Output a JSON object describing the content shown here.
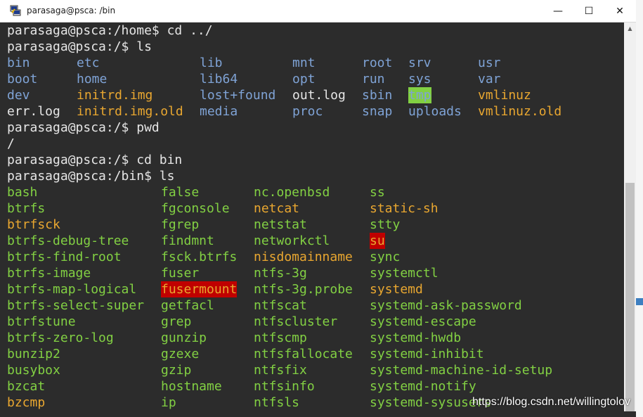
{
  "window": {
    "title": "parasaga@psca: /bin",
    "controls": {
      "minimize": "—",
      "maximize": "☐",
      "close": "✕"
    }
  },
  "terminal": {
    "lines": [
      {
        "text": "parasaga@psca:/home$ cd ../"
      },
      {
        "text": "parasaga@psca:/$ ls"
      },
      {
        "cells": [
          {
            "text": "bin",
            "color": "blue"
          },
          {
            "text": "etc",
            "color": "blue"
          },
          {
            "text": "lib",
            "color": "blue"
          },
          {
            "text": "mnt",
            "color": "blue"
          },
          {
            "text": "root",
            "color": "blue"
          },
          {
            "text": "srv",
            "color": "blue"
          },
          {
            "text": "usr",
            "color": "blue"
          }
        ]
      },
      {
        "cells": [
          {
            "text": "boot",
            "color": "blue"
          },
          {
            "text": "home",
            "color": "blue"
          },
          {
            "text": "lib64",
            "color": "blue"
          },
          {
            "text": "opt",
            "color": "blue"
          },
          {
            "text": "run",
            "color": "blue"
          },
          {
            "text": "sys",
            "color": "blue"
          },
          {
            "text": "var",
            "color": "blue"
          }
        ]
      },
      {
        "cells": [
          {
            "text": "dev",
            "color": "blue"
          },
          {
            "text": "initrd.img",
            "color": "yellow"
          },
          {
            "text": "lost+found",
            "color": "blue"
          },
          {
            "text": "out.log",
            "color": "white"
          },
          {
            "text": "sbin",
            "color": "blue"
          },
          {
            "text": "tmp",
            "color": "hl-tmp"
          },
          {
            "text": "vmlinuz",
            "color": "yellow"
          }
        ]
      },
      {
        "cells": [
          {
            "text": "err.log",
            "color": "white"
          },
          {
            "text": "initrd.img.old",
            "color": "yellow"
          },
          {
            "text": "media",
            "color": "blue"
          },
          {
            "text": "proc",
            "color": "blue"
          },
          {
            "text": "snap",
            "color": "blue"
          },
          {
            "text": "uploads",
            "color": "blue"
          },
          {
            "text": "vmlinuz.old",
            "color": "yellow"
          }
        ]
      },
      {
        "text": "parasaga@psca:/$ pwd"
      },
      {
        "text": "/"
      },
      {
        "text": "parasaga@psca:/$ cd bin"
      },
      {
        "text": "parasaga@psca:/bin$ ls"
      },
      {
        "cells": [
          {
            "text": "bash",
            "color": "green"
          },
          {
            "text": "false",
            "color": "green"
          },
          {
            "text": "nc.openbsd",
            "color": "green"
          },
          {
            "text": "ss",
            "color": "green"
          }
        ]
      },
      {
        "cells": [
          {
            "text": "btrfs",
            "color": "green"
          },
          {
            "text": "fgconsole",
            "color": "green"
          },
          {
            "text": "netcat",
            "color": "yellow"
          },
          {
            "text": "static-sh",
            "color": "yellow"
          }
        ]
      },
      {
        "cells": [
          {
            "text": "btrfsck",
            "color": "yellow"
          },
          {
            "text": "fgrep",
            "color": "green"
          },
          {
            "text": "netstat",
            "color": "green"
          },
          {
            "text": "stty",
            "color": "green"
          }
        ]
      },
      {
        "cells": [
          {
            "text": "btrfs-debug-tree",
            "color": "green"
          },
          {
            "text": "findmnt",
            "color": "green"
          },
          {
            "text": "networkctl",
            "color": "green"
          },
          {
            "text": "su",
            "color": "hl-red"
          }
        ]
      },
      {
        "cells": [
          {
            "text": "btrfs-find-root",
            "color": "green"
          },
          {
            "text": "fsck.btrfs",
            "color": "green"
          },
          {
            "text": "nisdomainname",
            "color": "yellow"
          },
          {
            "text": "sync",
            "color": "green"
          }
        ]
      },
      {
        "cells": [
          {
            "text": "btrfs-image",
            "color": "green"
          },
          {
            "text": "fuser",
            "color": "green"
          },
          {
            "text": "ntfs-3g",
            "color": "green"
          },
          {
            "text": "systemctl",
            "color": "green"
          }
        ]
      },
      {
        "cells": [
          {
            "text": "btrfs-map-logical",
            "color": "green"
          },
          {
            "text": "fusermount",
            "color": "hl-red"
          },
          {
            "text": "ntfs-3g.probe",
            "color": "green"
          },
          {
            "text": "systemd",
            "color": "yellow"
          }
        ]
      },
      {
        "cells": [
          {
            "text": "btrfs-select-super",
            "color": "green"
          },
          {
            "text": "getfacl",
            "color": "green"
          },
          {
            "text": "ntfscat",
            "color": "green"
          },
          {
            "text": "systemd-ask-password",
            "color": "green"
          }
        ]
      },
      {
        "cells": [
          {
            "text": "btrfstune",
            "color": "green"
          },
          {
            "text": "grep",
            "color": "green"
          },
          {
            "text": "ntfscluster",
            "color": "green"
          },
          {
            "text": "systemd-escape",
            "color": "green"
          }
        ]
      },
      {
        "cells": [
          {
            "text": "btrfs-zero-log",
            "color": "green"
          },
          {
            "text": "gunzip",
            "color": "green"
          },
          {
            "text": "ntfscmp",
            "color": "green"
          },
          {
            "text": "systemd-hwdb",
            "color": "green"
          }
        ]
      },
      {
        "cells": [
          {
            "text": "bunzip2",
            "color": "green"
          },
          {
            "text": "gzexe",
            "color": "green"
          },
          {
            "text": "ntfsfallocate",
            "color": "green"
          },
          {
            "text": "systemd-inhibit",
            "color": "green"
          }
        ]
      },
      {
        "cells": [
          {
            "text": "busybox",
            "color": "green"
          },
          {
            "text": "gzip",
            "color": "green"
          },
          {
            "text": "ntfsfix",
            "color": "green"
          },
          {
            "text": "systemd-machine-id-setup",
            "color": "green"
          }
        ]
      },
      {
        "cells": [
          {
            "text": "bzcat",
            "color": "green"
          },
          {
            "text": "hostname",
            "color": "green"
          },
          {
            "text": "ntfsinfo",
            "color": "green"
          },
          {
            "text": "systemd-notify",
            "color": "green"
          }
        ]
      },
      {
        "cells": [
          {
            "text": "bzcmp",
            "color": "yellow"
          },
          {
            "text": "ip",
            "color": "green"
          },
          {
            "text": "ntfsls",
            "color": "green"
          },
          {
            "text": "systemd-sysusers",
            "color": "green"
          }
        ]
      }
    ]
  },
  "watermark": "https://blog.csdn.net/willingtolov",
  "colors": {
    "terminal_bg": "#2c2c2c",
    "blue": "#7fa3d6",
    "yellow": "#e9a730",
    "green": "#82d043",
    "white": "#e6e6e6",
    "highlight_red": "#c00000"
  },
  "icons": {
    "app": "putty-icon",
    "minimize": "minimize-icon",
    "maximize": "maximize-icon",
    "close": "close-icon"
  }
}
